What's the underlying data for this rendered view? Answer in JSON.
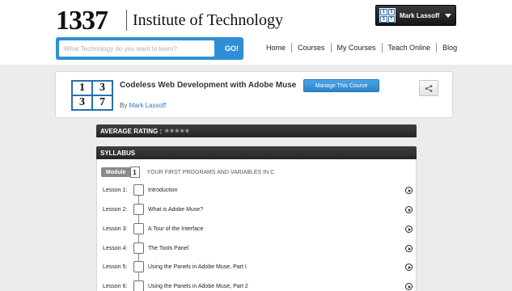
{
  "header": {
    "logo_number": "1337",
    "logo_text": "Institute of Technology",
    "user": {
      "name": "Mark Lassoff",
      "avatar_digits": [
        "1",
        "3",
        "3",
        "7"
      ]
    },
    "search": {
      "placeholder": "What Technology do you want to learn?",
      "button_label": "GO!"
    },
    "nav": [
      "Home",
      "Courses",
      "My Courses",
      "Teach Online",
      "Blog"
    ]
  },
  "course": {
    "logo_digits": [
      "1",
      "3",
      "3",
      "7"
    ],
    "title": "Codeless Web Development with Adobe Muse",
    "by_prefix": "By",
    "author": "Mark Lassoff",
    "manage_label": "Manage This Course",
    "share_icon": "share-icon"
  },
  "rating": {
    "label": "AVERAGE RATING :",
    "stars": "★★★★★"
  },
  "syllabus": {
    "label": "SYLLABUS",
    "module": {
      "tag": "Module",
      "number": "1",
      "title": "YOUR FIRST PROGRAMS AND VARIABLES IN C"
    },
    "lessons": [
      {
        "label": "Lesson 1:",
        "title": "Introduction"
      },
      {
        "label": "Lesson 2:",
        "title": "What is Adobe Muse?"
      },
      {
        "label": "Lesson 3:",
        "title": "A Tour of the Interface"
      },
      {
        "label": "Lesson 4:",
        "title": "The Tools Panel"
      },
      {
        "label": "Lesson 5:",
        "title": "Using the Panels in Adobe Muse, Part I"
      },
      {
        "label": "Lesson 6:",
        "title": "Using the Panels in Adobe Muse, Part 2"
      }
    ]
  }
}
